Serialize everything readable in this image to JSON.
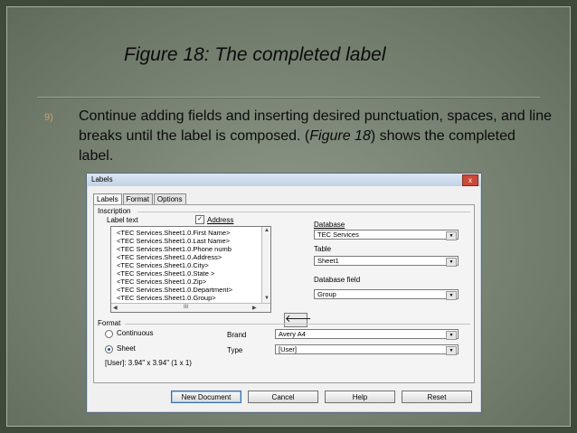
{
  "slide": {
    "title": "Figure 18: The completed label",
    "bullet_number": "9)",
    "bullet_text_1": "Continue adding fields and inserting desired punctuation, spaces, and line breaks until the label is composed. (",
    "bullet_text_figref": "Figure 18",
    "bullet_text_2": ") shows the completed label."
  },
  "dialog": {
    "title": "Labels",
    "close_glyph": "x",
    "tabs": [
      "Labels",
      "Format",
      "Options"
    ],
    "inscription_label": "Inscription",
    "label_text_label": "Label text",
    "address_label": "Address",
    "address_checked_glyph": "✓",
    "label_lines": [
      "<TEC Services.Sheet1.0.First Name>",
      "<TEC Services.Sheet1.0.Last Name>",
      "<TEC Services.Sheet1.0.Phone numb",
      "<TEC Services.Sheet1.0.Address>",
      "<TEC Services.Sheet1.0.City>",
      "<TEC Services.Sheet1.0.State >",
      "<TEC Services.Sheet1.0.Zip>",
      "<TEC Services.Sheet1.0.Department>",
      "<TEC Services.Sheet1.0.Group>"
    ],
    "hscroll_thumb": "III",
    "database_label": "Database",
    "database_value": "TEC Services",
    "table_label": "Table",
    "table_value": "Sheet1",
    "database_field_label": "Database field",
    "database_field_value": "Group",
    "insert_arrow": "🡐",
    "format_label": "Format",
    "continuous_label": "Continuous",
    "sheet_label": "Sheet",
    "brand_label": "Brand",
    "brand_value": "Avery A4",
    "type_label": "Type",
    "type_value": "[User]",
    "size_info": "[User]: 3.94\" x 3.94\" (1 x 1)",
    "buttons": {
      "new_document": "New Document",
      "cancel": "Cancel",
      "help": "Help",
      "reset": "Reset"
    }
  },
  "icons": {
    "dropdown": "chevron-down-icon",
    "insert": "arrow-left-icon"
  }
}
